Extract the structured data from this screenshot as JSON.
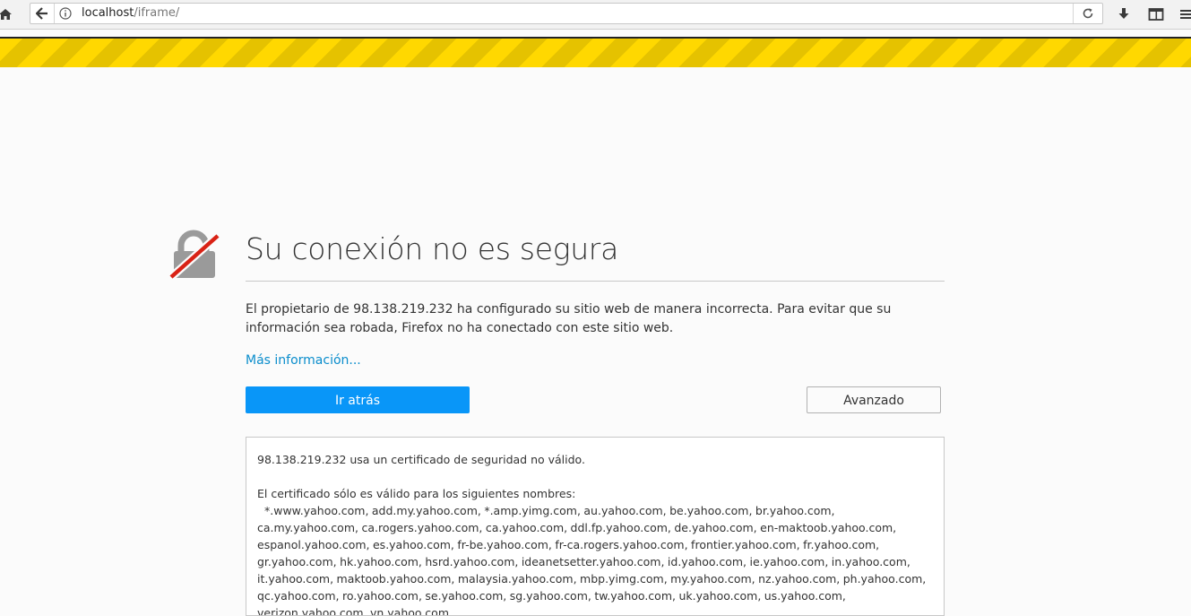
{
  "browser": {
    "url_host": "localhost",
    "url_path": "/iframe/",
    "icons": {
      "home": "home-icon",
      "back": "back-arrow-icon",
      "info": "info-icon",
      "reload": "reload-icon",
      "download": "download-icon",
      "sidebar": "sidebar-icon"
    }
  },
  "error_page": {
    "title": "Su conexión no es segura",
    "description": "El propietario de 98.138.219.232 ha configurado su sitio web de manera incorrecta. Para evitar que su información sea robada, Firefox no ha conectado con este sitio web.",
    "more_info_link": "Más información...",
    "go_back_button": "Ir atrás",
    "advanced_button": "Avanzado",
    "advanced": {
      "invalid_cert": "98.138.219.232 usa un certificado de seguridad no válido.",
      "valid_names_intro": "El certificado sólo es válido para los siguientes nombres:",
      "valid_names": "*.www.yahoo.com, add.my.yahoo.com, *.amp.yimg.com, au.yahoo.com, be.yahoo.com, br.yahoo.com, ca.my.yahoo.com, ca.rogers.yahoo.com, ca.yahoo.com, ddl.fp.yahoo.com, de.yahoo.com, en-maktoob.yahoo.com, espanol.yahoo.com, es.yahoo.com, fr-be.yahoo.com, fr-ca.rogers.yahoo.com, frontier.yahoo.com, fr.yahoo.com, gr.yahoo.com, hk.yahoo.com, hsrd.yahoo.com, ideanetsetter.yahoo.com, id.yahoo.com, ie.yahoo.com, in.yahoo.com, it.yahoo.com, maktoob.yahoo.com, malaysia.yahoo.com, mbp.yimg.com, my.yahoo.com, nz.yahoo.com, ph.yahoo.com, qc.yahoo.com, ro.yahoo.com, se.yahoo.com, sg.yahoo.com, tw.yahoo.com, uk.yahoo.com, us.yahoo.com, verizon.yahoo.com, vn.yahoo.com,"
    }
  },
  "colors": {
    "warning_stripe": "#ffd800",
    "primary_button": "#0996f8",
    "link": "#0a8dcc",
    "broken_lock_slash": "#d92215"
  }
}
